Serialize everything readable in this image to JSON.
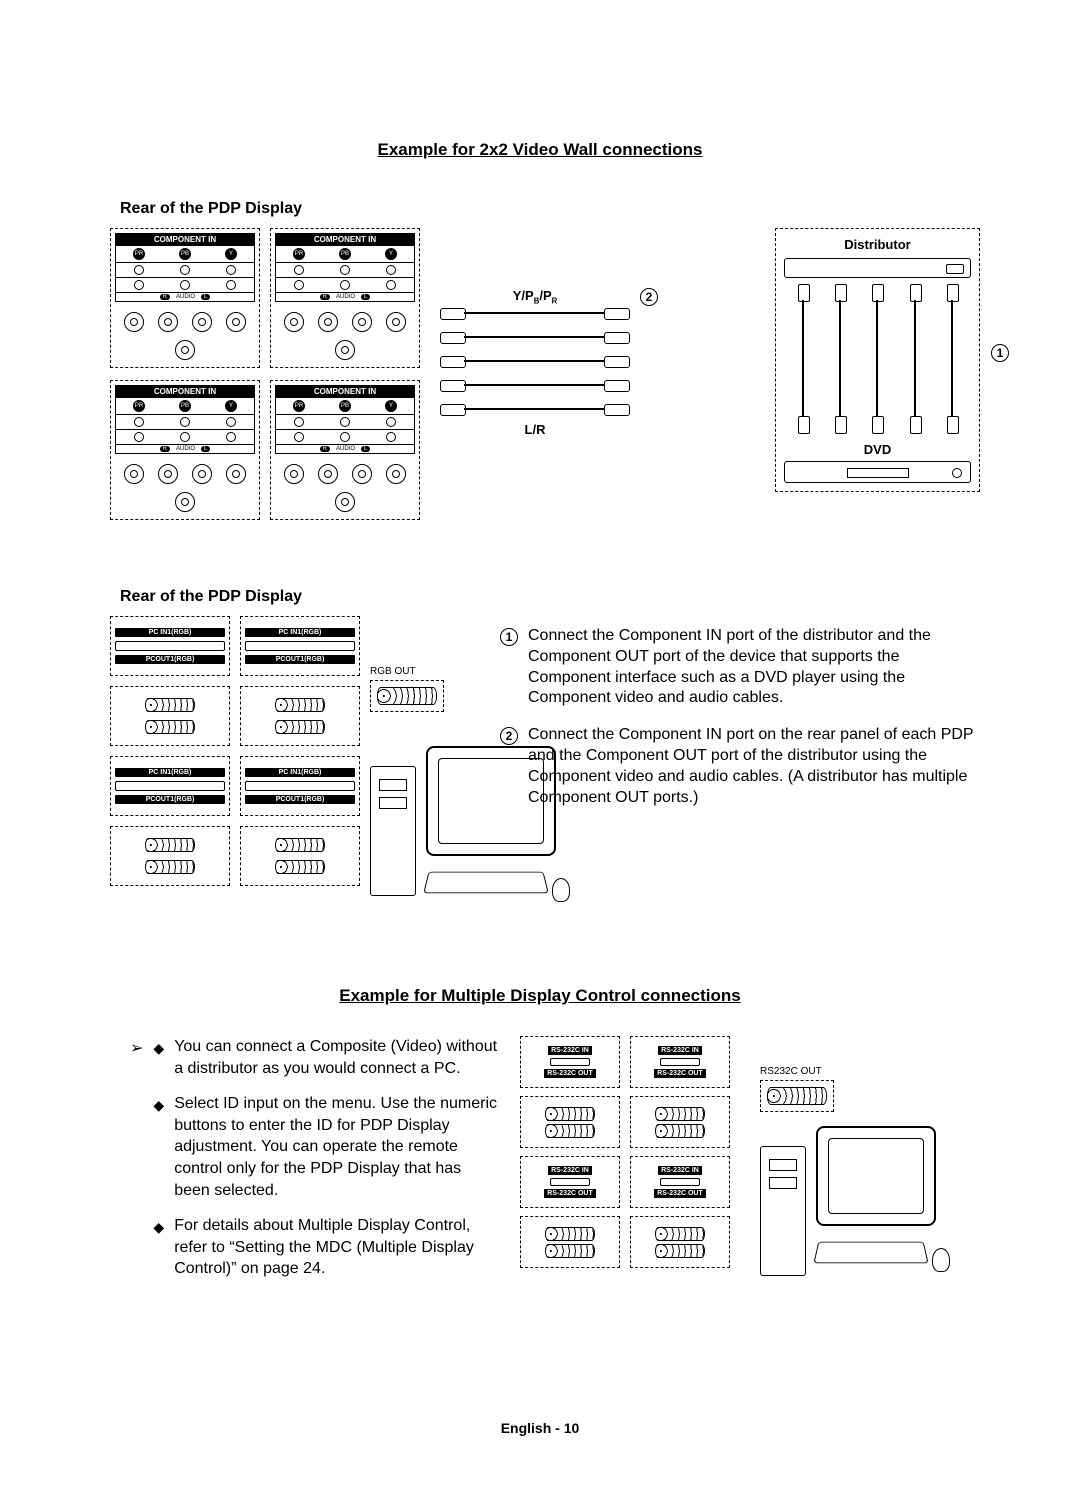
{
  "section1": {
    "title": "Example for 2x2 Video Wall connections",
    "rear_label": "Rear of the PDP Display",
    "component_in": "COMPONENT IN",
    "port_labels": {
      "pr": "PR",
      "pb": "PB",
      "y": "Y"
    },
    "audio": {
      "r": "R",
      "label": "AUDIO",
      "l": "L"
    },
    "cable_upper_label": "Y/PB/PR",
    "cable_lower_label": "L/R",
    "distributor_label": "Distributor",
    "dvd_label": "DVD",
    "step1": "Connect the Component IN port of the distributor and the Component OUT port of the device that supports the Component interface such as a DVD player using the Component video and audio cables.",
    "step2": "Connect the Component IN port on the rear panel of each PDP and the Component OUT port of the distributor using the Component video and audio cables. (A distributor has multiple Component OUT ports.)"
  },
  "section2": {
    "rear_label": "Rear of the PDP Display",
    "pc_in_label": "PC IN1(RGB)",
    "pc_out_label": "PCOUT1(RGB)",
    "rgb_out_label": "RGB OUT"
  },
  "section3": {
    "title": "Example for Multiple Display Control connections",
    "bullet1": "You can connect a Composite (Video) without a distributor as you would connect a PC.",
    "bullet2": "Select ID input on the menu. Use the numeric buttons to enter the ID for PDP Display adjustment. You can operate the remote control only for the PDP Display that has been selected.",
    "bullet3": "For details about Multiple Display Control, refer to “Setting the MDC (Multiple Display Control)” on page 24.",
    "rs232_in": "RS-232C IN",
    "rs232_out": "RS-232C OUT",
    "rs232c_out_label": "RS232C OUT"
  },
  "footer": "English - 10"
}
